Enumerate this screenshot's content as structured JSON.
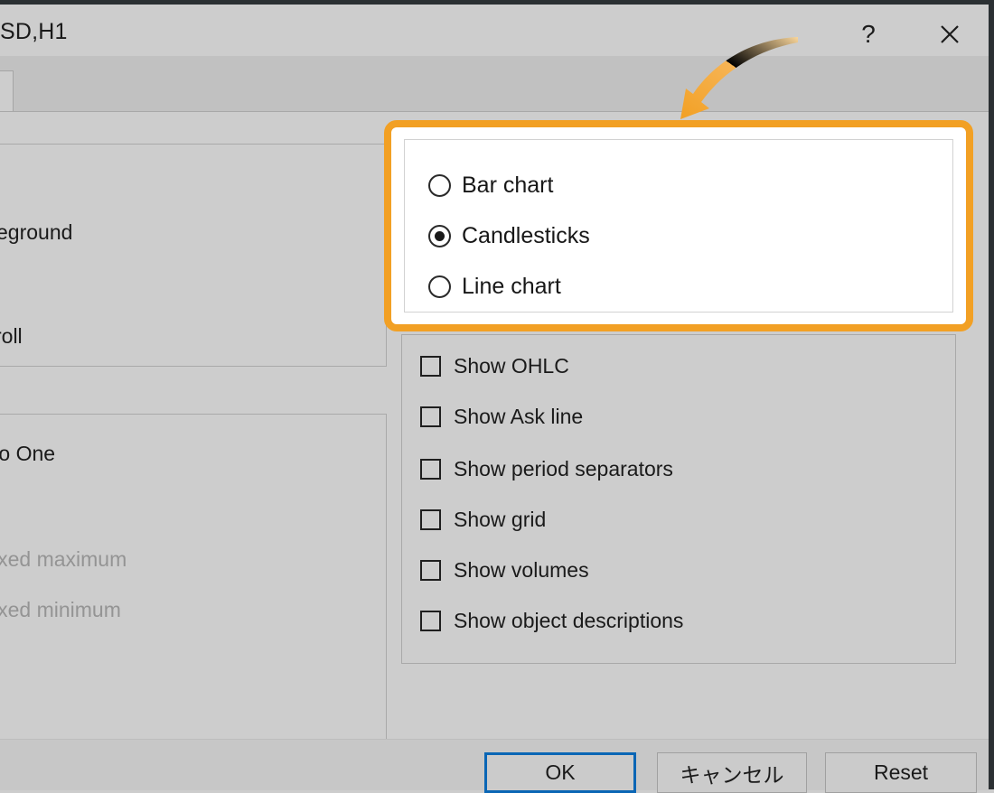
{
  "window": {
    "title": "SD,H1",
    "help_label": "?",
    "close_icon": "close-icon"
  },
  "left_panel": {
    "truncated_labels": [
      "eground",
      "roll",
      " to One"
    ],
    "disabled_labels": [
      "ixed maximum",
      "ixed minimum"
    ]
  },
  "chart_type": {
    "selected": "Candlesticks",
    "options": [
      {
        "label": "Bar chart",
        "checked": false
      },
      {
        "label": "Candlesticks",
        "checked": true
      },
      {
        "label": "Line chart",
        "checked": false
      }
    ]
  },
  "display_options": [
    {
      "label": "Show OHLC",
      "checked": false
    },
    {
      "label": "Show Ask line",
      "checked": false
    },
    {
      "label": "Show period separators",
      "checked": false
    },
    {
      "label": "Show grid",
      "checked": false
    },
    {
      "label": "Show volumes",
      "checked": false
    },
    {
      "label": "Show object descriptions",
      "checked": false
    }
  ],
  "footer": {
    "ok_label": "OK",
    "cancel_label": "キャンセル",
    "reset_label": "Reset"
  },
  "annotation": {
    "highlight_color": "#F2A024",
    "arrow_icon": "curved-arrow-icon"
  }
}
